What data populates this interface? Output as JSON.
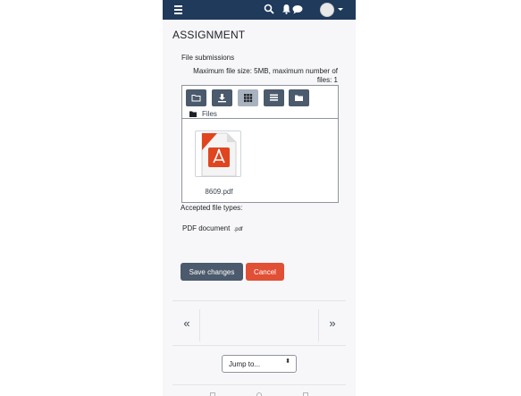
{
  "navbar": {
    "menu_icon": "hamburger-icon",
    "search_icon": "search-icon",
    "notifications_icon": "bell-icon",
    "messages_icon": "chat-icon",
    "user_menu_icon": "avatar"
  },
  "page": {
    "title": "ASSIGNMENT"
  },
  "submission": {
    "section_label": "File submissions",
    "max_info": "Maximum file size: 5MB, maximum number of files: 1",
    "path_label": "Files",
    "toolbar": [
      "folder-icon",
      "download-icon",
      "grid-view-icon",
      "list-view-icon",
      "tree-view-icon"
    ],
    "files": [
      {
        "name": "8609.pdf",
        "icon": "pdf-file-icon"
      }
    ],
    "accepted_label": "Accepted file types:",
    "accepted_type": "PDF document",
    "accepted_ext": ".pdf"
  },
  "actions": {
    "save_label": "Save changes",
    "cancel_label": "Cancel",
    "save_color": "#4b5a6c",
    "cancel_color": "#e14f35"
  },
  "pagination": {
    "prev_label": "«",
    "next_label": "»"
  },
  "jump": {
    "label": "Jump to...",
    "arrow": "⬍"
  },
  "colors": {
    "navbar": "#1f3a5b",
    "page_bg": "#f7f7f9"
  }
}
